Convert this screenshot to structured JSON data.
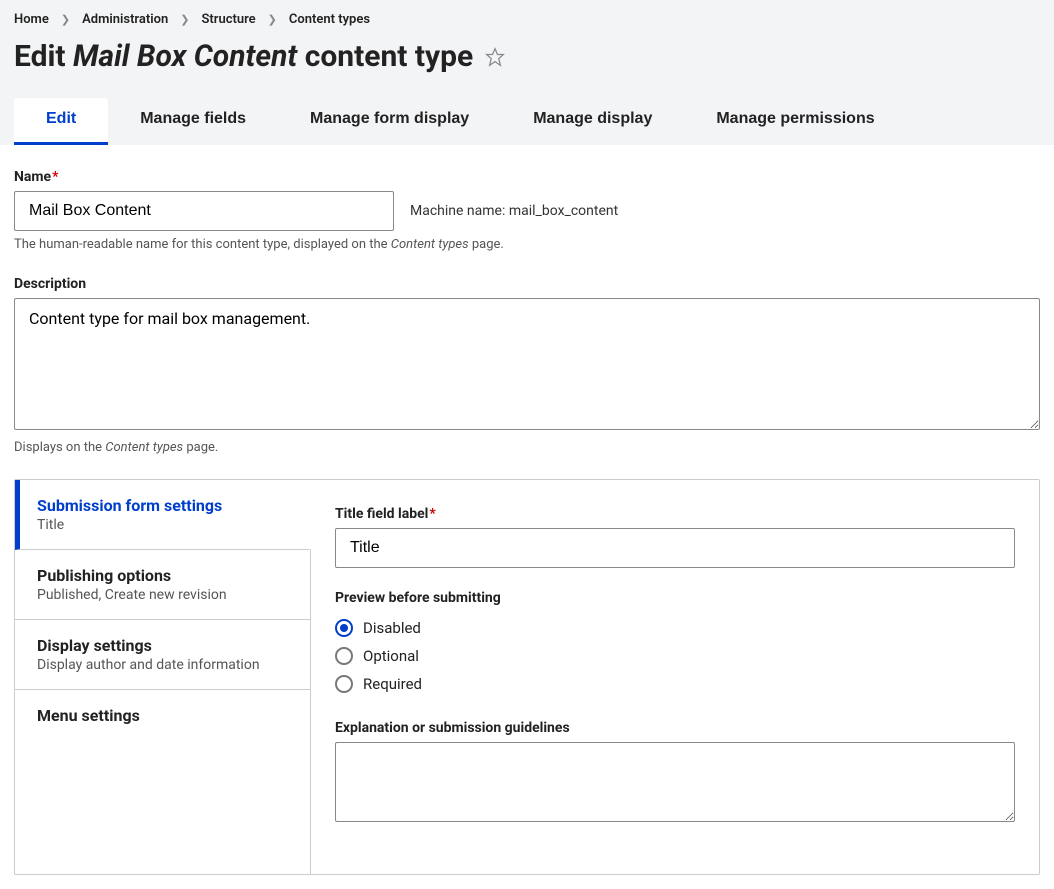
{
  "breadcrumb": {
    "items": [
      {
        "label": "Home"
      },
      {
        "label": "Administration"
      },
      {
        "label": "Structure"
      },
      {
        "label": "Content types"
      }
    ]
  },
  "page_title": {
    "prefix": "Edit",
    "name": "Mail Box Content",
    "suffix": "content type"
  },
  "tabs": {
    "items": [
      {
        "label": "Edit",
        "active": true
      },
      {
        "label": "Manage fields",
        "active": false
      },
      {
        "label": "Manage form display",
        "active": false
      },
      {
        "label": "Manage display",
        "active": false
      },
      {
        "label": "Manage permissions",
        "active": false
      }
    ]
  },
  "form": {
    "name": {
      "label": "Name",
      "value": "Mail Box Content",
      "machine_name_label": "Machine name:",
      "machine_name_value": "mail_box_content",
      "help_prefix": "The human-readable name for this content type, displayed on the ",
      "help_italic": "Content types",
      "help_suffix": " page."
    },
    "description": {
      "label": "Description",
      "value": "Content type for mail box management.",
      "help_prefix": "Displays on the ",
      "help_italic": "Content types",
      "help_suffix": " page."
    }
  },
  "vtabs": {
    "items": [
      {
        "title": "Submission form settings",
        "summary": "Title",
        "active": true
      },
      {
        "title": "Publishing options",
        "summary": "Published, Create new revision",
        "active": false
      },
      {
        "title": "Display settings",
        "summary": "Display author and date information",
        "active": false
      },
      {
        "title": "Menu settings",
        "summary": "",
        "active": false
      }
    ],
    "submission": {
      "title_label": "Title field label",
      "title_value": "Title",
      "preview_legend": "Preview before submitting",
      "preview_options": [
        {
          "label": "Disabled",
          "checked": true
        },
        {
          "label": "Optional",
          "checked": false
        },
        {
          "label": "Required",
          "checked": false
        }
      ],
      "guidelines_label": "Explanation or submission guidelines",
      "guidelines_value": ""
    }
  }
}
